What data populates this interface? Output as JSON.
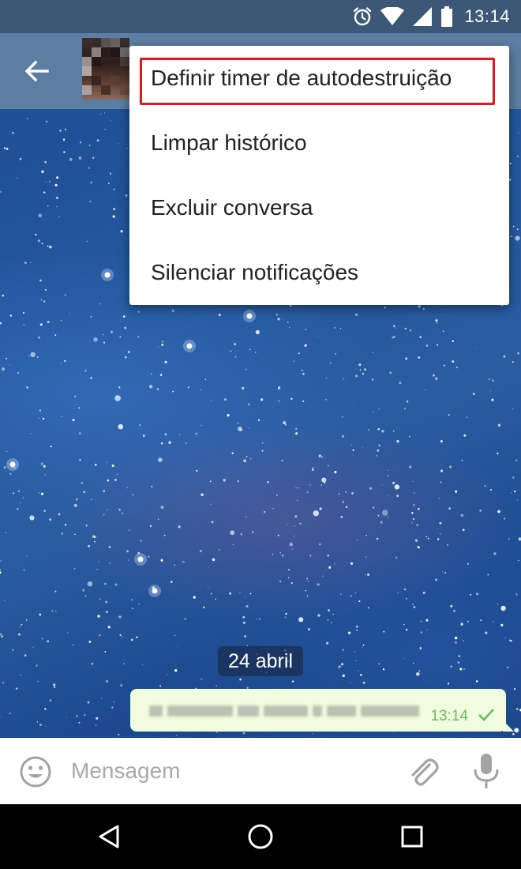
{
  "status_bar": {
    "time": "13:14",
    "icons": [
      "alarm-icon",
      "wifi-icon",
      "signal-icon",
      "battery-icon"
    ]
  },
  "app_bar": {
    "back_icon": "arrow-left-icon",
    "avatar": "pixelated-contact-photo"
  },
  "menu": {
    "items": [
      {
        "label": "Definir timer de autodestruição",
        "highlighted": true
      },
      {
        "label": "Limpar histórico"
      },
      {
        "label": "Excluir conversa"
      },
      {
        "label": "Silenciar notificações"
      }
    ],
    "highlight_color": "#e5161f"
  },
  "chat": {
    "date_label": "24 abril",
    "message": {
      "text_blurred": true,
      "time": "13:14",
      "status_icon": "check-icon",
      "bubble_color": "#effdde",
      "time_color": "#6fb860"
    }
  },
  "input_bar": {
    "placeholder": "Mensagem",
    "emoji_icon": "emoji-icon",
    "attach_icon": "paperclip-icon",
    "mic_icon": "microphone-icon"
  },
  "nav_bar": {
    "buttons": [
      "back-triangle-icon",
      "home-circle-icon",
      "recents-square-icon"
    ]
  },
  "colors": {
    "status_bar": "#3c5877",
    "app_bar": "#5c7ea3",
    "wallpaper": "#24589f"
  }
}
